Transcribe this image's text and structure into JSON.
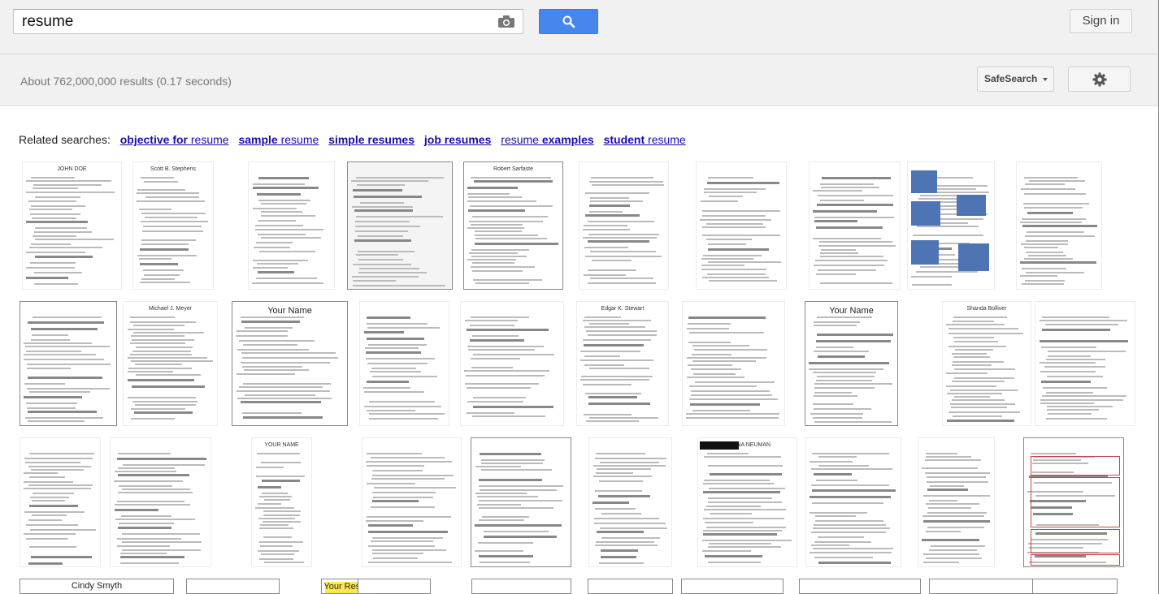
{
  "search": {
    "query": "resume"
  },
  "header": {
    "signin_label": "Sign in"
  },
  "toolbar": {
    "stats": "About 762,000,000 results (0.17 seconds)",
    "safesearch_label": "SafeSearch"
  },
  "related": {
    "label": "Related searches:",
    "items": [
      {
        "bold": "objective for",
        "rest": " resume"
      },
      {
        "bold": "sample",
        "rest": " resume"
      },
      {
        "bold": "simple resumes",
        "rest": ""
      },
      {
        "bold": "job resumes",
        "rest": ""
      },
      {
        "plain": "resume ",
        "bold": "examples"
      },
      {
        "bold": "student",
        "rest": " resume"
      }
    ]
  },
  "thumbnails": {
    "row1": [
      {
        "title": "JOHN DOE"
      },
      {
        "title": "Scott B. Stephens"
      },
      {
        "title": ""
      },
      {
        "title": ""
      },
      {
        "title": "Robert Sarfaste"
      },
      {
        "title": ""
      },
      {
        "title": ""
      },
      {
        "title": ""
      },
      {
        "title": ""
      },
      {
        "title": ""
      }
    ],
    "row2": [
      {
        "title": ""
      },
      {
        "title": "Michael J. Meyer"
      },
      {
        "title": "Your Name"
      },
      {
        "title": ""
      },
      {
        "title": ""
      },
      {
        "title": "Edgar K. Stewart"
      },
      {
        "title": ""
      },
      {
        "title": "Your Name"
      },
      {
        "title": "Shanda Bolliver"
      }
    ],
    "row3": [
      {
        "title": ""
      },
      {
        "title": ""
      },
      {
        "title": "YOUR NAME"
      },
      {
        "title": ""
      },
      {
        "title": ""
      },
      {
        "title": ""
      },
      {
        "title": "DONNA NEUMAN"
      },
      {
        "title": ""
      },
      {
        "title": ""
      },
      {
        "title": ""
      }
    ],
    "row4": [
      {
        "title": "Cindy Smyth"
      },
      {
        "title": ""
      },
      {
        "title": "Your Resume"
      }
    ]
  },
  "icons": {
    "camera": "camera-icon",
    "search": "search-icon",
    "gear": "gear-icon",
    "caret": "caret-down-icon"
  },
  "colors": {
    "search_button": "#4787ed",
    "link": "#1a0dab",
    "topbar": "#f1f1f1"
  }
}
